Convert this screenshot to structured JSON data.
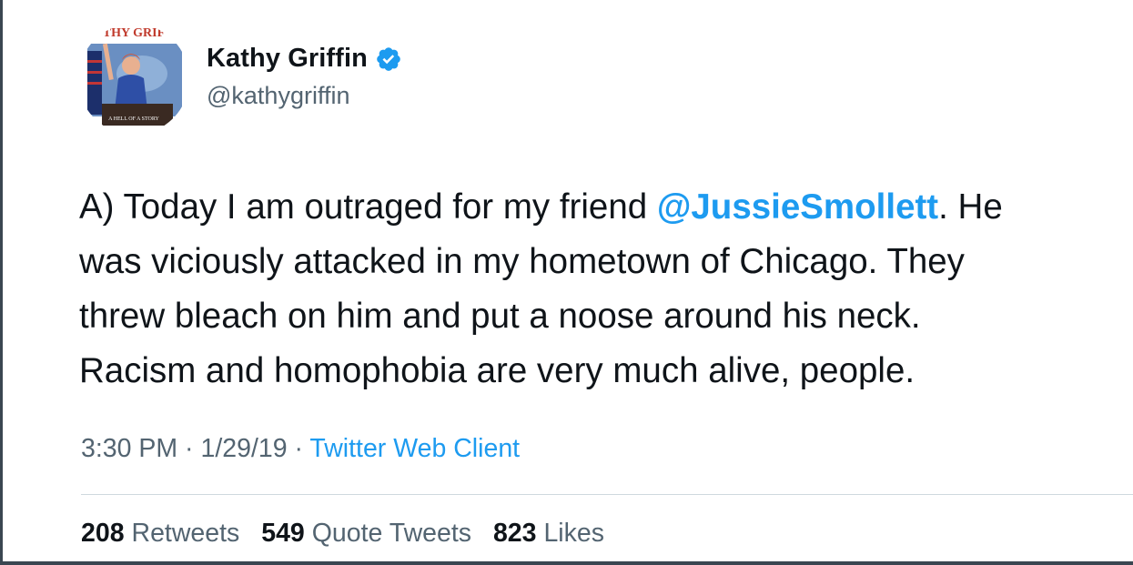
{
  "author": {
    "name": "Kathy Griffin",
    "handle": "@kathygriffin",
    "verified": true,
    "avatar_text_top": "THY GRIF",
    "avatar_text_bottom": "A HELL OF A STORY"
  },
  "tweet": {
    "line1_start": "A) Today I am outraged for my friend ",
    "mention": "@JussieSmollett",
    "line1_end": ".  He",
    "line2": "was viciously attacked in my hometown of Chicago. They",
    "line3": "threw bleach on him and put a noose around his neck.",
    "line4": "Racism and homophobia are very much alive, people."
  },
  "meta": {
    "time": "3:30 PM",
    "sep1": " · ",
    "date": "1/29/19",
    "sep2": " · ",
    "source": "Twitter Web Client"
  },
  "stats": {
    "retweets_count": "208",
    "retweets_label": "Retweets",
    "quotes_count": "549",
    "quotes_label": "Quote Tweets",
    "likes_count": "823",
    "likes_label": "Likes"
  },
  "colors": {
    "link": "#1d9bf0",
    "text": "#0f1419",
    "secondary": "#536471"
  },
  "icons": [
    "verified-badge-icon"
  ]
}
